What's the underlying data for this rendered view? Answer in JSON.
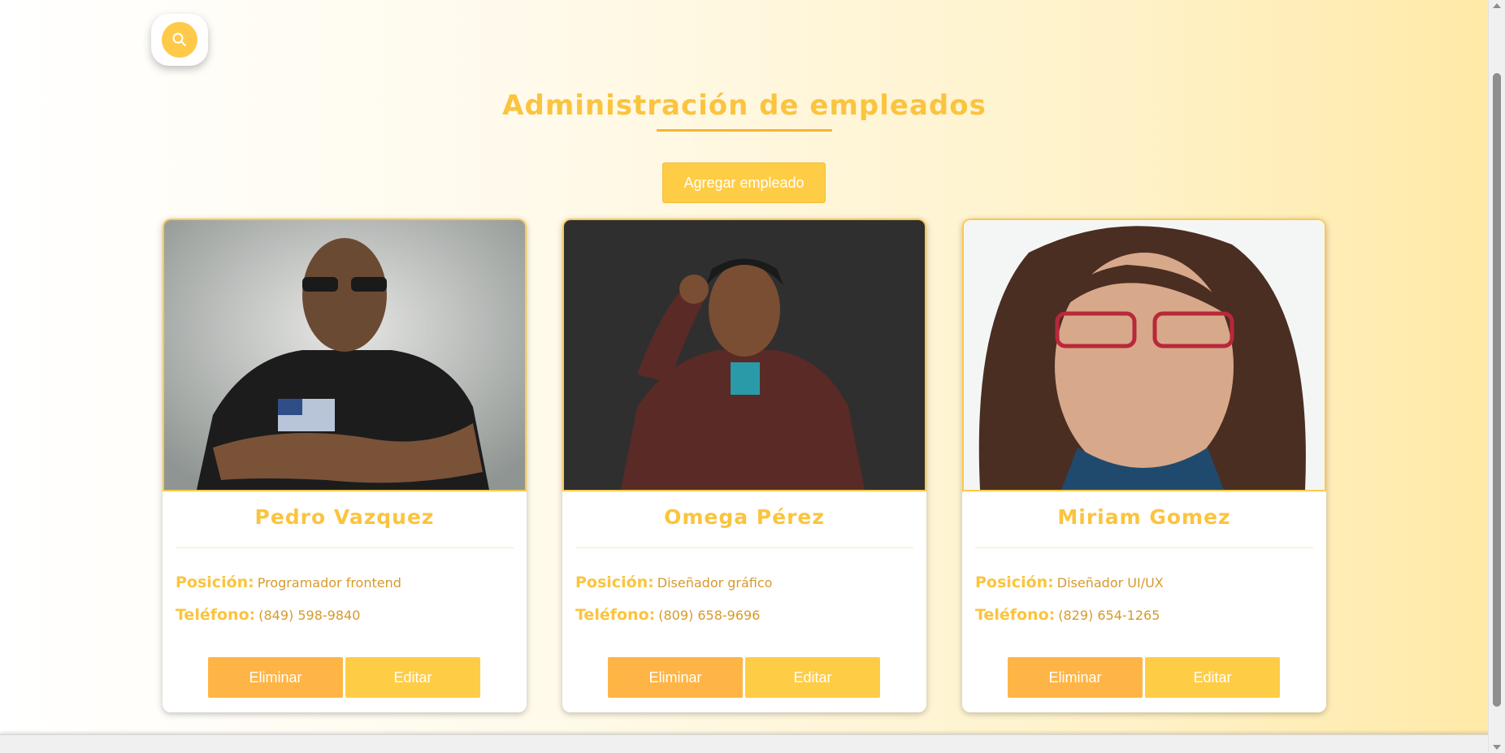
{
  "search": {
    "icon": "search-icon"
  },
  "header": {
    "title": "Administración de empleados"
  },
  "actions": {
    "add_label": "Agregar empleado"
  },
  "labels": {
    "position": "Posición:",
    "phone": "Teléfono:",
    "delete": "Eliminar",
    "edit": "Editar"
  },
  "employees": [
    {
      "name": "Pedro Vazquez",
      "position": "Programador frontend",
      "phone": "(849) 598-9840"
    },
    {
      "name": "Omega Pérez",
      "position": "Diseñador gráfico",
      "phone": "(809) 658-9696"
    },
    {
      "name": "Miriam Gomez",
      "position": "Diseñador UI/UX",
      "phone": "(829) 654-1265"
    }
  ],
  "colors": {
    "accent": "#fbc43f",
    "button": "#ffcc45",
    "delete_button": "#ffb545"
  }
}
